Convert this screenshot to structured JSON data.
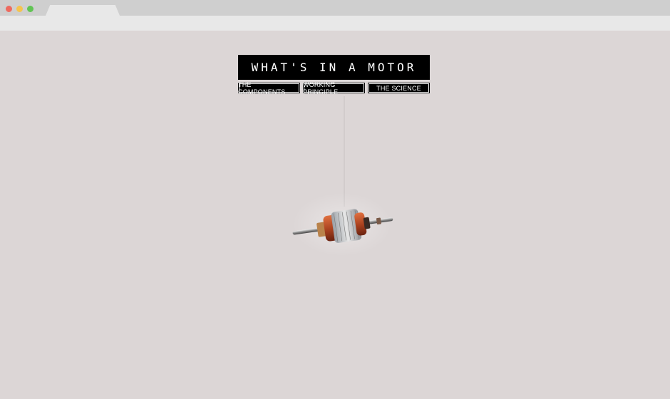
{
  "title": "WHAT'S IN A MOTOR",
  "nav": {
    "components": "THE COMPONENTS",
    "working": "WORKING PRINCIPLE",
    "science": "THE SCIENCE"
  }
}
